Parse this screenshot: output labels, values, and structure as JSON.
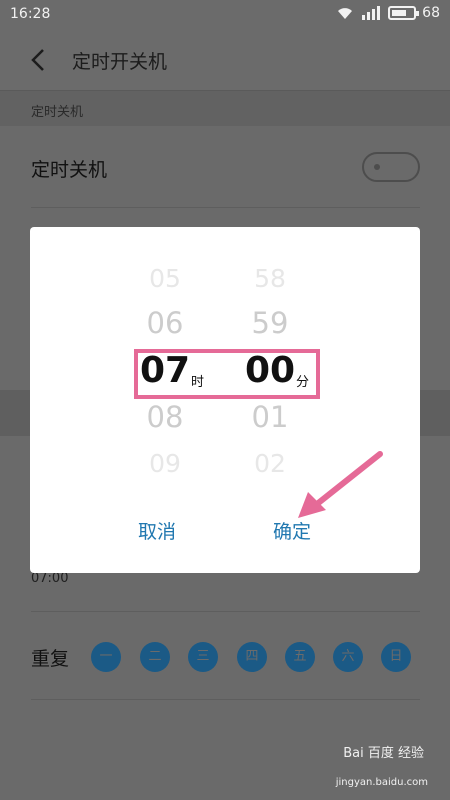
{
  "status": {
    "time": "16:28",
    "battery_pct": 68,
    "battery_text": "68"
  },
  "header": {
    "title": "定时开关机"
  },
  "section": {
    "title": "定时关机"
  },
  "rows": {
    "shutdown_label": "定时关机",
    "shutdown_toggle": "off"
  },
  "schedule": {
    "time_value": "07:00",
    "repeat_label": "重复",
    "days": [
      "一",
      "二",
      "三",
      "四",
      "五",
      "六",
      "日"
    ]
  },
  "picker": {
    "hours": [
      "05",
      "06",
      "07",
      "08",
      "09"
    ],
    "minutes": [
      "58",
      "59",
      "00",
      "01",
      "02"
    ],
    "hour_unit": "时",
    "minute_unit": "分",
    "cancel_label": "取消",
    "confirm_label": "确定"
  },
  "watermark": {
    "brand": "Bai 百度 经验",
    "url": "jingyan.baidu.com"
  },
  "colors": {
    "accent": "#2178b0",
    "highlight": "#e56a97",
    "day_bg": "#1b5a86"
  }
}
